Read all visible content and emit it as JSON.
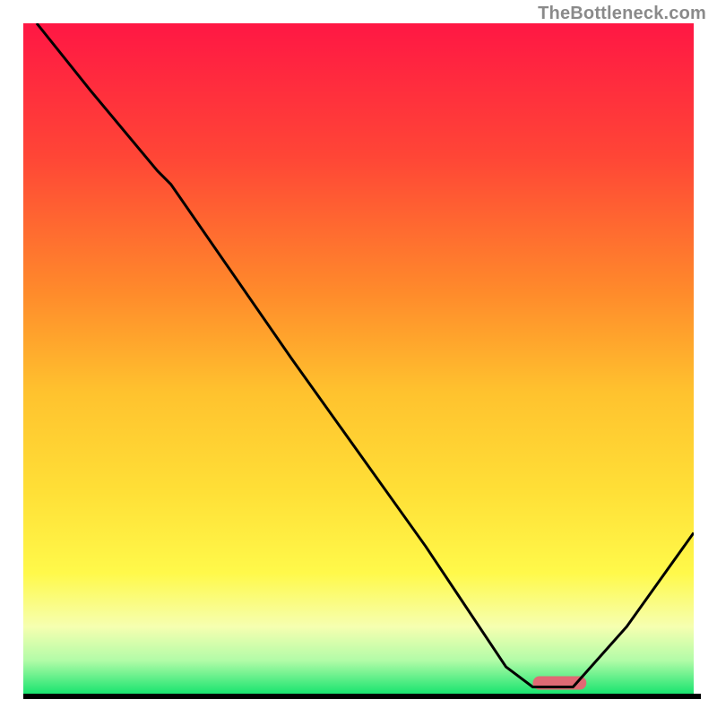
{
  "watermark": "TheBottleneck.com",
  "chart_data": {
    "type": "line",
    "title": "",
    "xlabel": "",
    "ylabel": "",
    "xlim": [
      0,
      100
    ],
    "ylim": [
      0,
      100
    ],
    "background_gradient": {
      "kind": "rainbow-vertical",
      "stops": [
        {
          "offset": 0.0,
          "color": "#ff1744"
        },
        {
          "offset": 0.2,
          "color": "#ff4636"
        },
        {
          "offset": 0.4,
          "color": "#ff8a2b"
        },
        {
          "offset": 0.55,
          "color": "#ffc22e"
        },
        {
          "offset": 0.7,
          "color": "#ffe037"
        },
        {
          "offset": 0.82,
          "color": "#fff94a"
        },
        {
          "offset": 0.9,
          "color": "#f6ffb0"
        },
        {
          "offset": 0.95,
          "color": "#b3fca8"
        },
        {
          "offset": 1.0,
          "color": "#19e46f"
        }
      ]
    },
    "series": [
      {
        "name": "bottleneck-curve",
        "color": "#000000",
        "stroke_width": 3,
        "x": [
          2,
          10,
          20,
          22,
          40,
          60,
          72,
          76,
          82,
          90,
          100
        ],
        "y": [
          100,
          90,
          78,
          76,
          50,
          22,
          4,
          1,
          1,
          10,
          24
        ]
      }
    ],
    "markers": [
      {
        "name": "optimal-zone",
        "shape": "rounded-bar",
        "color": "#e06a74",
        "x_start": 76,
        "x_end": 84,
        "y": 0.6,
        "height": 2.0
      }
    ]
  }
}
